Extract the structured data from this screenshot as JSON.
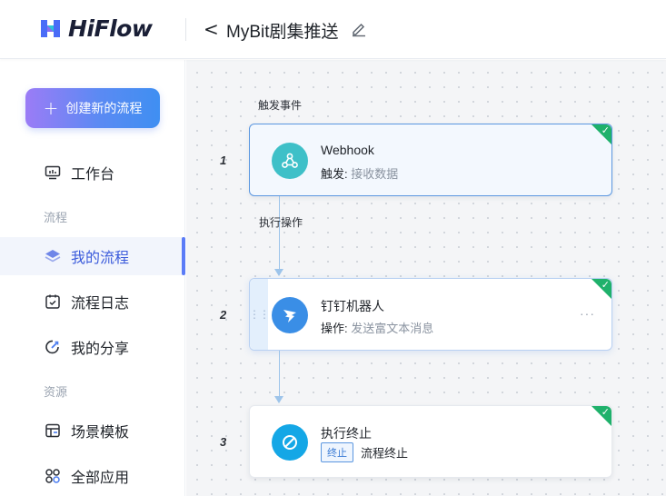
{
  "app": {
    "logo_text": "HiFlow"
  },
  "header": {
    "back_label": "<",
    "title": "MyBit剧集推送"
  },
  "sidebar": {
    "create_button": "创建新的流程",
    "workbench": "工作台",
    "section_flow": "流程",
    "items_flow": [
      "我的流程",
      "流程日志",
      "我的分享"
    ],
    "section_resource": "资源",
    "items_resource": [
      "场景模板",
      "全部应用"
    ]
  },
  "canvas": {
    "trigger_caption": "触发事件",
    "action_caption": "执行操作",
    "steps": [
      {
        "number": "1",
        "title": "Webhook",
        "sub_label": "触发:",
        "sub_value": "接收数据",
        "icon": "webhook-icon",
        "status": "done"
      },
      {
        "number": "2",
        "title": "钉钉机器人",
        "sub_label": "操作:",
        "sub_value": "发送富文本消息",
        "icon": "dingtalk-icon",
        "status": "done"
      },
      {
        "number": "3",
        "title": "执行终止",
        "tag": "终止",
        "sub_value": "流程终止",
        "icon": "stop-icon",
        "status": "done"
      }
    ],
    "more_label": "···"
  },
  "colors": {
    "accent": "#5b7cf7",
    "success": "#1fb16b",
    "webhook": "#3ec0c8",
    "dingtalk": "#3a8ee6",
    "stop": "#14a7e6"
  }
}
